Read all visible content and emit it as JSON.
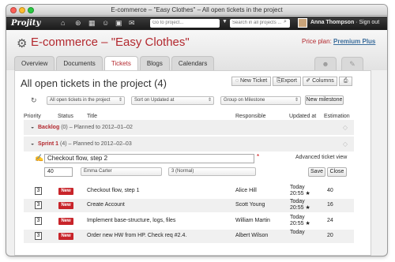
{
  "window": {
    "title": "E-commerce – \"Easy Clothes\" – All open tickets in the project"
  },
  "topbar": {
    "logo": "Projity",
    "goto_placeholder": "Go to project...",
    "search_placeholder": "Search in all projects ...",
    "user_name": "Anna Thompson",
    "sign_out": "· Sign out"
  },
  "project": {
    "title": "E-commerce – \"Easy Clothes\"",
    "price_label": "Price plan:",
    "price_plan": "Premium Plus"
  },
  "tabs": [
    "Overview",
    "Documents",
    "Tickets",
    "Blogs",
    "Calendars"
  ],
  "active_tab": "Tickets",
  "page": {
    "title": "All open tickets in the project (4)"
  },
  "toolbar": {
    "new_ticket": "New Ticket",
    "export": "Export",
    "columns": "Columns"
  },
  "filters": {
    "scope": "All open tickets in the project",
    "sort": "Sort on Updated at",
    "group": "Group on Milestone",
    "new_milestone": "New milestone"
  },
  "columns": {
    "priority": "Priority",
    "status": "Status",
    "title": "Title",
    "responsible": "Responsible",
    "updated_at": "Updated at",
    "estimation": "Estimation"
  },
  "groups": [
    {
      "name": "Backlog",
      "count": "(0)",
      "planned": "– Planned to 2012–01–02"
    },
    {
      "name": "Sprint 1",
      "count": "(4)",
      "planned": "– Planned to 2012–02–03"
    }
  ],
  "editor": {
    "title_value": "Checkout flow, step 2",
    "advanced": "Advanced ticket view",
    "estimation": "40",
    "assignee": "Emma Carter",
    "priority": "3 (Normal)",
    "save": "Save",
    "close": "Close"
  },
  "tickets": [
    {
      "priority": "3",
      "status": "New",
      "title": "Checkout flow, step 1",
      "responsible": "Alice Hill",
      "updated_day": "Today",
      "updated_time": "20:55 ★",
      "estimation": "40"
    },
    {
      "priority": "3",
      "status": "New",
      "title": "Create Account",
      "responsible": "Scott Young",
      "updated_day": "Today",
      "updated_time": "20:55 ★",
      "estimation": "16"
    },
    {
      "priority": "3",
      "status": "New",
      "title": "Implement base-structure, logs, files",
      "responsible": "William Martin",
      "updated_day": "Today",
      "updated_time": "20:55 ★",
      "estimation": "24"
    },
    {
      "priority": "3",
      "status": "New",
      "title": "Order new HW from HP. Check req #2.4.",
      "responsible": "Albert Wilson",
      "updated_day": "Today",
      "updated_time": "",
      "estimation": "20"
    }
  ],
  "colors": {
    "brand_red": "#b3282e",
    "badge_red": "#c8242a",
    "link_blue": "#3a6c9b"
  }
}
